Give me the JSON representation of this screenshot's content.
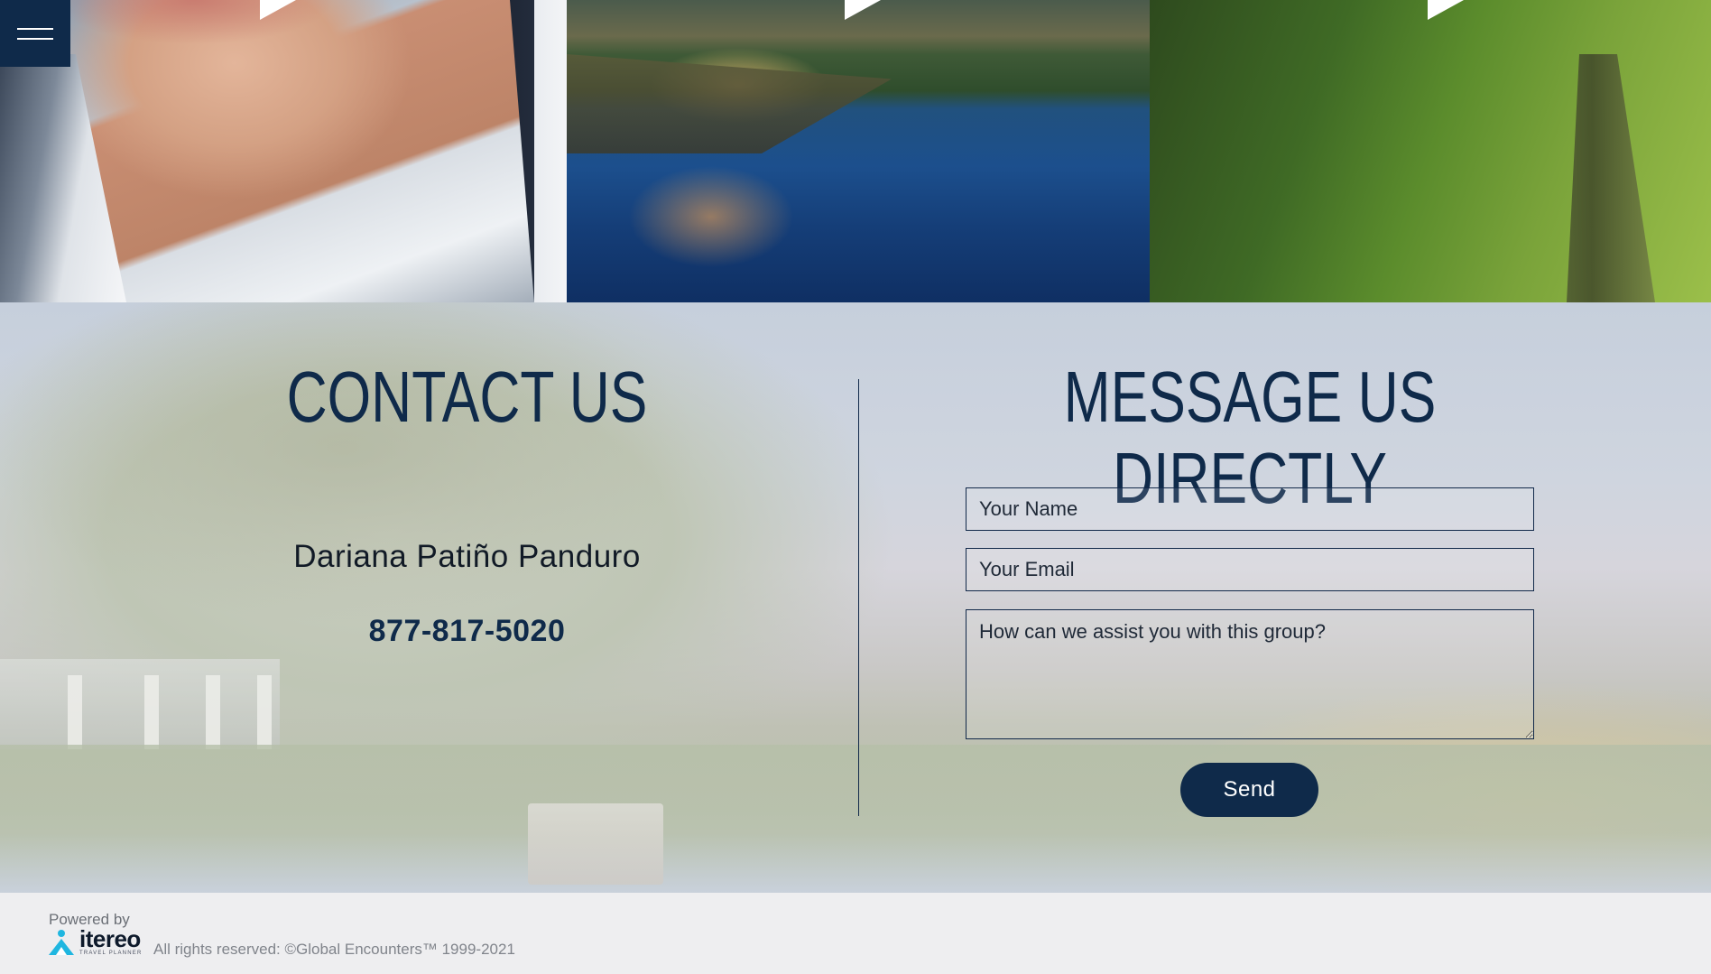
{
  "nav": {
    "menu_icon": "hamburger-menu-icon"
  },
  "gallery": {
    "tiles": [
      {
        "name": "portrait-photo",
        "icon": "play-icon"
      },
      {
        "name": "lakeside-dinner-photo",
        "icon": "play-icon"
      },
      {
        "name": "grassland-path-photo",
        "icon": "play-icon"
      }
    ]
  },
  "contact": {
    "title": "CONTACT US",
    "name": "Dariana Patiño Panduro",
    "phone": "877-817-5020"
  },
  "message": {
    "title": "MESSAGE US DIRECTLY",
    "name_placeholder": "Your Name",
    "email_placeholder": "Your Email",
    "message_placeholder": "How can we assist you with this group?",
    "send_label": "Send"
  },
  "footer": {
    "powered_by": "Powered by",
    "logo_word": "itereo",
    "logo_sub": "TRAVEL PLANNER",
    "copyright": "All rights reserved: ©Global Encounters™ 1999-2021"
  },
  "colors": {
    "brand_navy": "#0f2a4a",
    "footer_bg": "#eeeef0",
    "logo_accent": "#1fb6e0"
  }
}
